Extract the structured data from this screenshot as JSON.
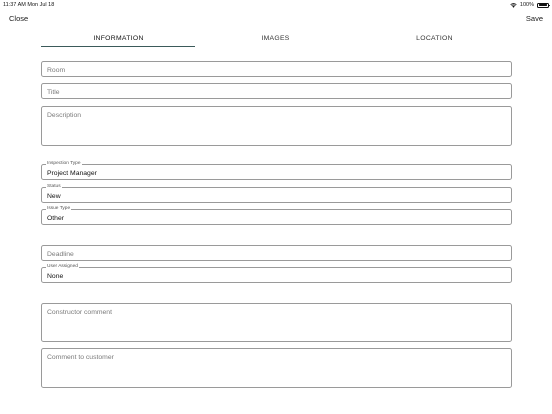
{
  "status_bar": {
    "time_date": "11:37 AM   Mon Jul 18",
    "battery": "100%",
    "battery_level": 1.0
  },
  "nav": {
    "close_label": "Close",
    "save_label": "Save"
  },
  "tabs": [
    {
      "label": "INFORMATION",
      "active": true
    },
    {
      "label": "IMAGES",
      "active": false
    },
    {
      "label": "LOCATION",
      "active": false
    }
  ],
  "form": {
    "room": {
      "placeholder": "Room",
      "value": ""
    },
    "title": {
      "placeholder": "Title",
      "value": ""
    },
    "description": {
      "placeholder": "Description",
      "value": ""
    },
    "inspection_type": {
      "label": "Inspection Type",
      "value": "Project Manager"
    },
    "status": {
      "label": "Status",
      "value": "New"
    },
    "issue_type": {
      "label": "Issue Type",
      "value": "Other"
    },
    "deadline": {
      "placeholder": "Deadline",
      "value": ""
    },
    "user_assigned": {
      "label": "User Assigned",
      "value": "None"
    },
    "constructor_comment": {
      "placeholder": "Constructor comment",
      "value": ""
    },
    "comment_to_customer": {
      "placeholder": "Comment to customer",
      "value": ""
    }
  },
  "colors": {
    "tab_underline": "#3b5a5a",
    "field_border": "#9a9a9a",
    "placeholder_text": "#7a7a7a"
  }
}
